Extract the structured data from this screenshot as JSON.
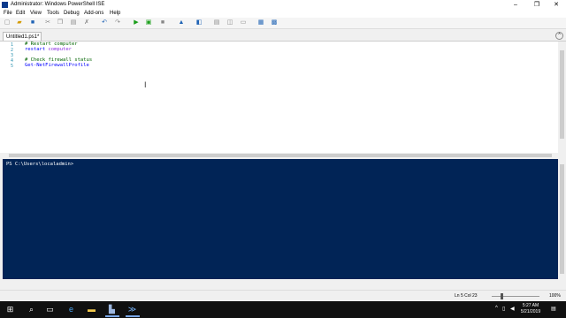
{
  "window": {
    "title": "Administrator: Windows PowerShell ISE"
  },
  "menu": [
    "File",
    "Edit",
    "View",
    "Tools",
    "Debug",
    "Add-ons",
    "Help"
  ],
  "tab": {
    "label": "Untitled1.ps1*"
  },
  "editor": {
    "line_numbers": [
      "1",
      "2",
      "3",
      "4",
      "5"
    ],
    "lines": [
      {
        "parts": [
          {
            "t": "# Restart computer",
            "c": "cmt"
          }
        ]
      },
      {
        "parts": [
          {
            "t": "restart ",
            "c": "cmd"
          },
          {
            "t": "computer",
            "c": "arg"
          }
        ]
      },
      {
        "parts": []
      },
      {
        "parts": [
          {
            "t": "# Check firewall status",
            "c": "cmt"
          }
        ]
      },
      {
        "parts": [
          {
            "t": "Get-NetFirewallProfile",
            "c": "cmd"
          }
        ]
      }
    ]
  },
  "console": {
    "prompt": "PS C:\\Users\\localadmin>"
  },
  "status": {
    "position": "Ln 5  Col 23",
    "zoom": "100%"
  },
  "taskbar": {
    "time": "5:27 AM",
    "date": "5/21/2019"
  },
  "colors": {
    "console_bg": "#012456",
    "comment": "#006400",
    "command": "#0000ff",
    "argument": "#8a2be2"
  }
}
